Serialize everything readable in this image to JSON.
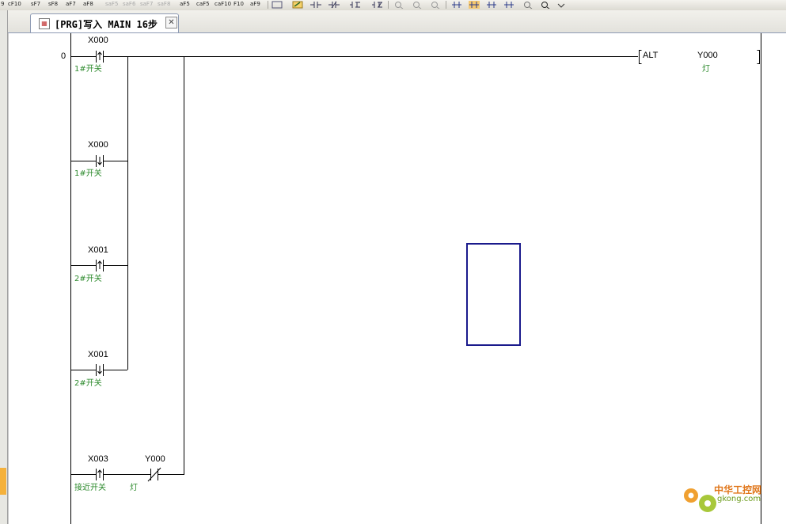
{
  "toolbar": {
    "keys": [
      "9",
      "cF10",
      "sF7",
      "sF8",
      "aF7",
      "aF8",
      "saF5",
      "saF6",
      "saF7",
      "saF8",
      "aF5",
      "caF5",
      "caF10",
      "F10",
      "aF9"
    ]
  },
  "tab": {
    "title": "[PRG]写入 MAIN 16步",
    "close": "✕"
  },
  "ladder": {
    "step_number": "0",
    "contacts": [
      {
        "device": "X000",
        "comment": "1#开关"
      },
      {
        "device": "X000",
        "comment": "1#开关"
      },
      {
        "device": "X001",
        "comment": "2#开关"
      },
      {
        "device": "X001",
        "comment": "2#开关"
      },
      {
        "device": "X003",
        "comment": "接近开关"
      },
      {
        "device": "Y000",
        "comment": "灯"
      }
    ],
    "instruction": {
      "name": "ALT",
      "operand": "Y000",
      "comment": "灯"
    }
  },
  "watermark": {
    "text": "中华工控网",
    "url": "gkong.com"
  },
  "colors": {
    "comment": "#2e8b2e",
    "cursor": "#1a1a8c",
    "rung": "#000000"
  }
}
